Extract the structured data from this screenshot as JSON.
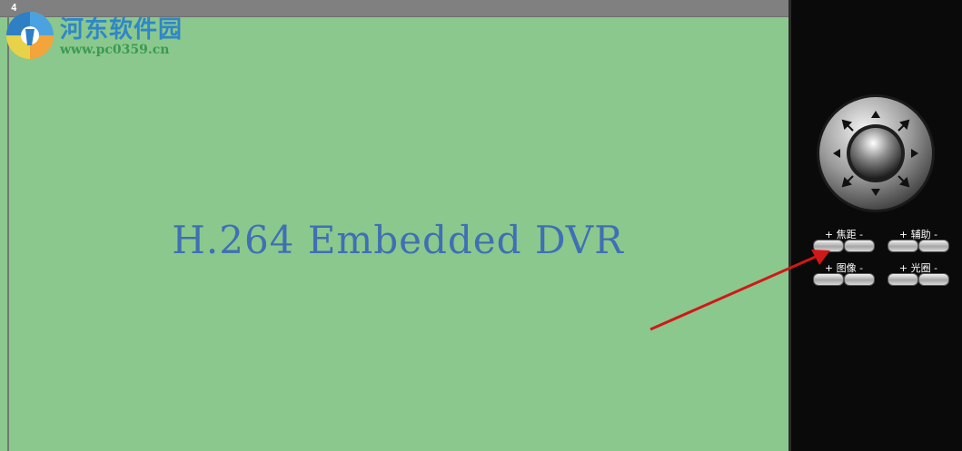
{
  "video": {
    "channel_number": "4",
    "banner_text": "H.264 Embedded DVR"
  },
  "watermark": {
    "title": "河东软件园",
    "url": "www.pc0359.cn"
  },
  "controls": {
    "focus": {
      "plus": "+",
      "label": "焦距",
      "minus": "-"
    },
    "aux": {
      "plus": "+",
      "label": "辅助",
      "minus": "-"
    },
    "image": {
      "plus": "+",
      "label": "图像",
      "minus": "-"
    },
    "iris": {
      "plus": "+",
      "label": "光圈",
      "minus": "-"
    }
  },
  "colors": {
    "video_bg": "#8bc88d",
    "banner_text": "#3f6fb4",
    "panel_bg": "#0a0a0a",
    "annotation_arrow": "#d01818"
  },
  "icons": {
    "ptz": "ptz-direction-dial",
    "annotation": "red-arrow"
  }
}
